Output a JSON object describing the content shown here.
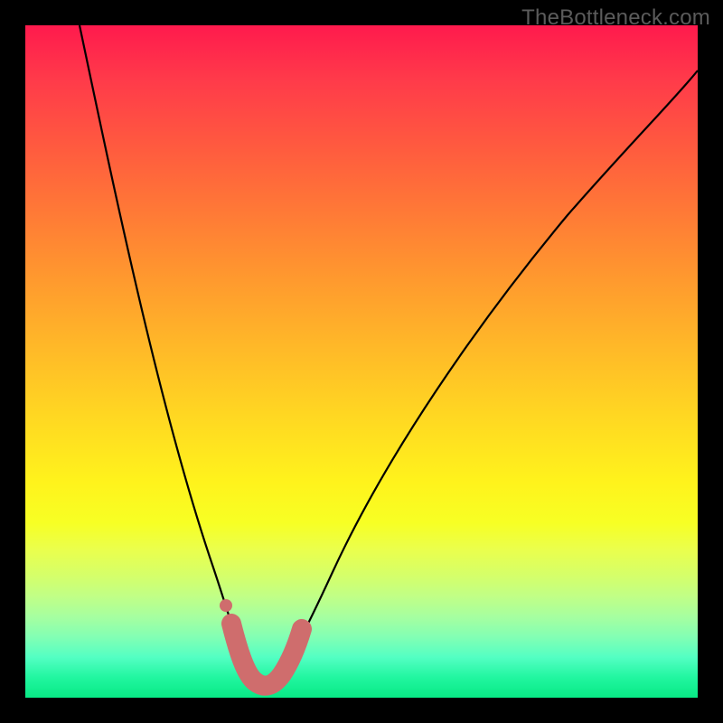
{
  "watermark": "TheBottleneck.com",
  "colors": {
    "frame_bg": "#000000",
    "curve_stroke": "#000000",
    "band_stroke": "#cf6d6d",
    "watermark_text": "#5b5b5b"
  },
  "chart_data": {
    "type": "line",
    "title": "",
    "xlabel": "",
    "ylabel": "",
    "xlim": [
      0,
      100
    ],
    "ylim": [
      0,
      100
    ],
    "grid": false,
    "series": [
      {
        "name": "bottleneck_curve",
        "x": [
          8,
          10,
          12,
          14,
          16,
          18,
          20,
          22,
          24,
          26,
          28,
          30,
          31,
          32,
          33,
          34,
          35,
          36,
          38,
          40,
          44,
          48,
          54,
          60,
          68,
          76,
          84,
          92,
          100
        ],
        "y": [
          100,
          90,
          80,
          70,
          61,
          53,
          45,
          38,
          31,
          25,
          19,
          13,
          9,
          6,
          3,
          2,
          2,
          2,
          4,
          8,
          16,
          26,
          38,
          48,
          60,
          70,
          79,
          87,
          94
        ]
      }
    ],
    "highlight_band": {
      "name": "optimal_region",
      "x": [
        30.5,
        31,
        32,
        33,
        34,
        35,
        36,
        37,
        38
      ],
      "y": [
        9,
        7,
        4,
        2.2,
        1.8,
        1.8,
        2.2,
        3.5,
        6
      ]
    },
    "marker": {
      "name": "indicator_dot",
      "x": 30.2,
      "y": 12
    }
  }
}
